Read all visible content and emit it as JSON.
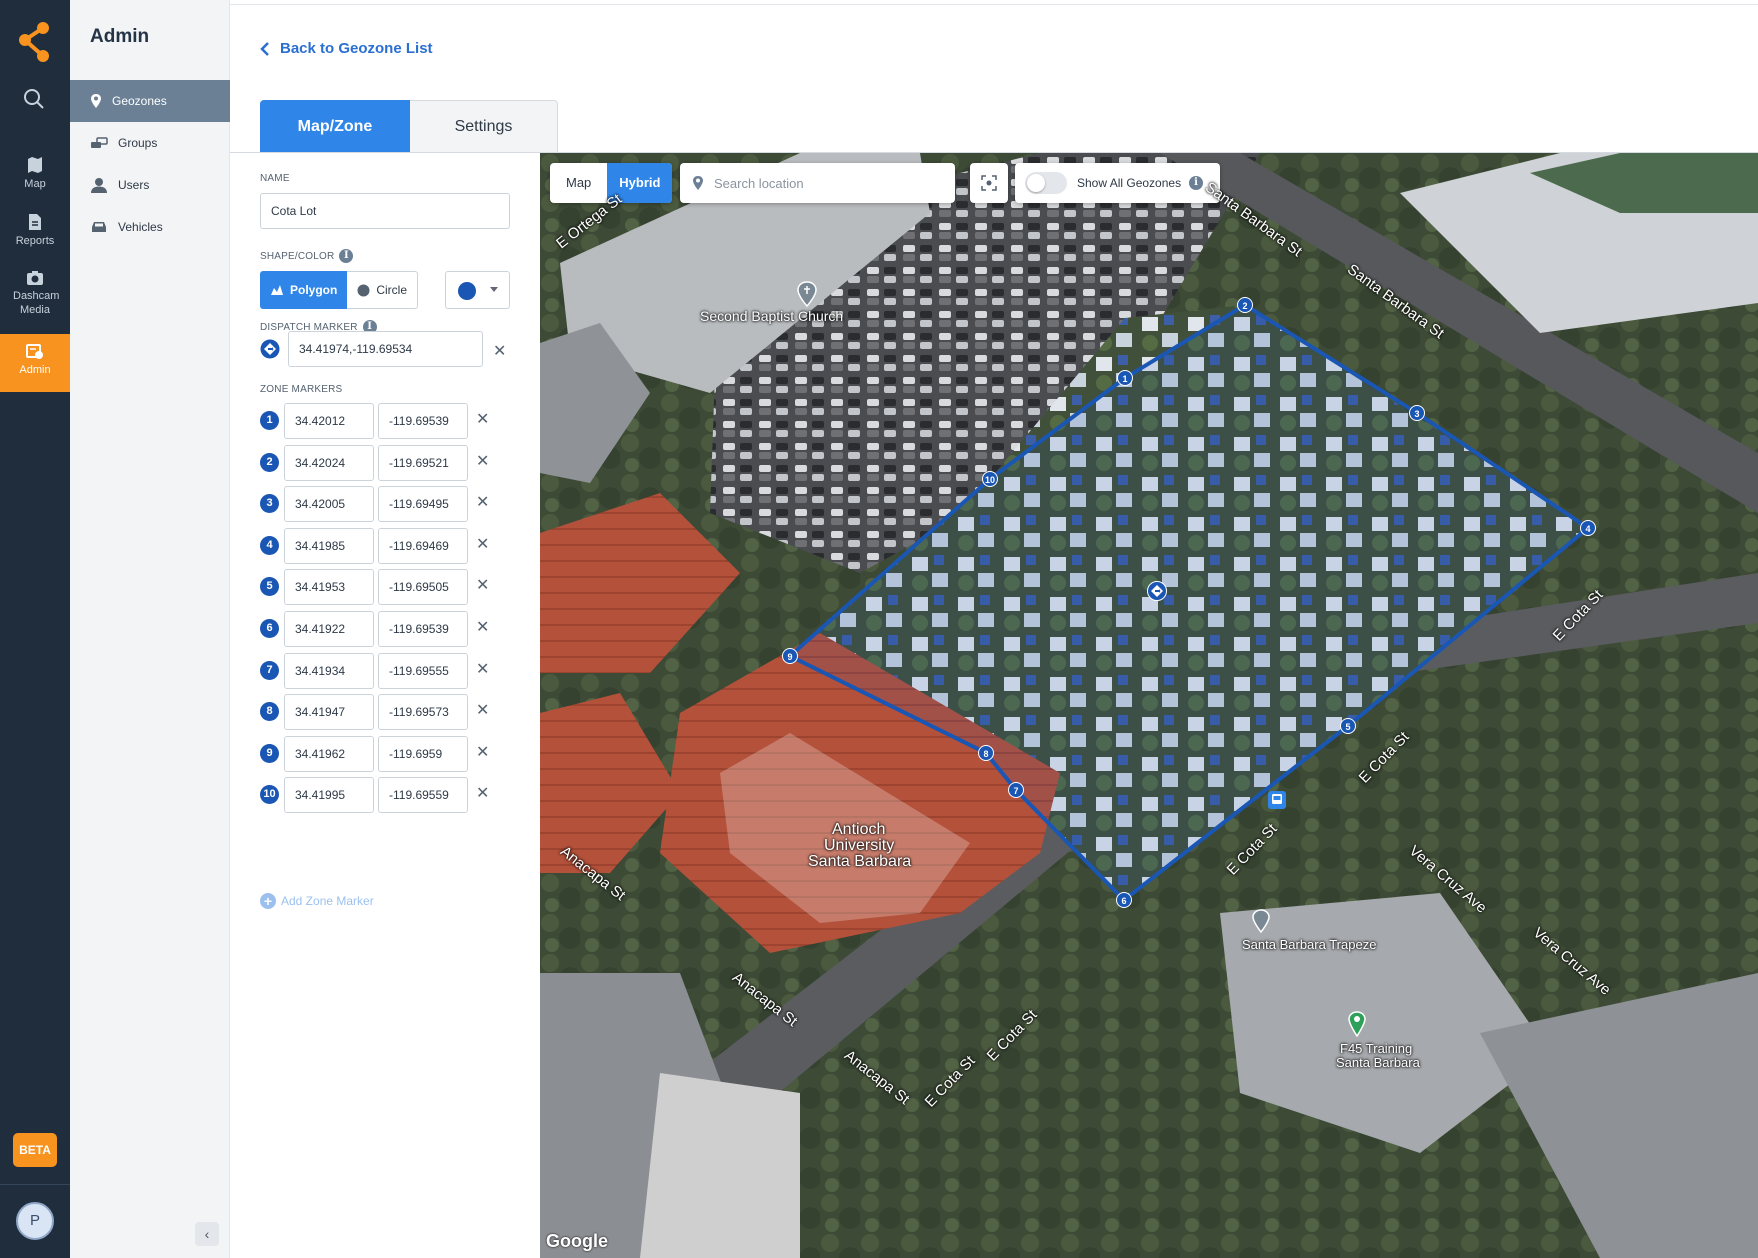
{
  "sidebar_rail": {
    "items": [
      {
        "label": "Map",
        "icon": "map-icon"
      },
      {
        "label": "Reports",
        "icon": "reports-icon"
      },
      {
        "label": "Dashcam Media",
        "icon": "camera-icon"
      },
      {
        "label": "Admin",
        "icon": "admin-icon"
      }
    ],
    "beta": "BETA",
    "avatar": "P"
  },
  "admin_menu": {
    "title": "Admin",
    "items": [
      {
        "label": "Geozones",
        "icon": "location-pin-icon"
      },
      {
        "label": "Groups",
        "icon": "groups-icon"
      },
      {
        "label": "Users",
        "icon": "user-icon"
      },
      {
        "label": "Vehicles",
        "icon": "car-icon"
      }
    ]
  },
  "back_link": "Back to Geozone List",
  "tabs": [
    {
      "label": "Map/Zone"
    },
    {
      "label": "Settings"
    }
  ],
  "form": {
    "name_label": "NAME",
    "name_value": "Cota Lot",
    "shape_label": "SHAPE/COLOR",
    "shape_options": [
      "Polygon",
      "Circle"
    ],
    "color": "#1a56b4",
    "dispatch_label": "DISPATCH MARKER",
    "dispatch_value": "34.41974,-119.69534",
    "zone_markers_label": "ZONE MARKERS",
    "zone_markers": [
      {
        "n": "1",
        "lat": "34.42012",
        "lng": "-119.69539"
      },
      {
        "n": "2",
        "lat": "34.42024",
        "lng": "-119.69521"
      },
      {
        "n": "3",
        "lat": "34.42005",
        "lng": "-119.69495"
      },
      {
        "n": "4",
        "lat": "34.41985",
        "lng": "-119.69469"
      },
      {
        "n": "5",
        "lat": "34.41953",
        "lng": "-119.69505"
      },
      {
        "n": "6",
        "lat": "34.41922",
        "lng": "-119.69539"
      },
      {
        "n": "7",
        "lat": "34.41934",
        "lng": "-119.69555"
      },
      {
        "n": "8",
        "lat": "34.41947",
        "lng": "-119.69573"
      },
      {
        "n": "9",
        "lat": "34.41962",
        "lng": "-119.6959"
      },
      {
        "n": "10",
        "lat": "34.41995",
        "lng": "-119.69559"
      }
    ],
    "add_marker": "Add Zone Marker"
  },
  "map": {
    "type_map": "Map",
    "type_hybrid": "Hybrid",
    "search_placeholder": "Search location",
    "show_all_geozones": "Show All Geozones",
    "labels": {
      "church": "Second Baptist Church",
      "antioch_1": "Antioch",
      "antioch_2": "University",
      "antioch_3": "Santa Barbara",
      "trapeze": "Santa Barbara Trapeze",
      "f45_1": "F45 Training",
      "f45_2": "Santa Barbara"
    },
    "streets": {
      "ortega": "E Ortega St",
      "santa_barbara_1": "Santa Barbara St",
      "santa_barbara_2": "Santa Barbara St",
      "cota_1": "E Cota St",
      "cota_2": "E Cota St",
      "cota_3": "E Cota St",
      "cota_4": "E Cota St",
      "cota_5": "E Cota St",
      "vera_cruz_1": "Vera Cruz Ave",
      "vera_cruz_2": "Vera Cruz Ave",
      "anacapa_1": "Anacapa St",
      "anacapa_2": "Anacapa St",
      "anacapa_3": "Anacapa St"
    },
    "attribution": "Google"
  }
}
